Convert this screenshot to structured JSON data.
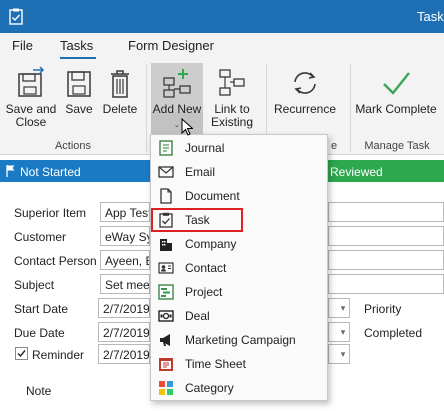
{
  "window": {
    "title": "Task"
  },
  "ribbon": {
    "tabs": [
      "File",
      "Tasks",
      "Form Designer"
    ],
    "buttons": {
      "save_and_close": "Save and\nClose",
      "save": "Save",
      "delete": "Delete",
      "add_new": "Add New",
      "link_to_existing": "Link to\nExisting",
      "recurrence": "Recurrence",
      "mark_complete": "Mark Complete"
    },
    "groups": {
      "actions": "Actions",
      "manage_task": "Manage Task",
      "recurrence_fragment": "e"
    }
  },
  "status": {
    "current_stage": "Not Started",
    "next_stage": "e Reviewed"
  },
  "form": {
    "superior_item": {
      "label": "Superior Item",
      "value": "App Test"
    },
    "customer": {
      "label": "Customer",
      "value": "eWay Sys"
    },
    "contact_person": {
      "label": "Contact Person",
      "value": "Ayeen, Ev"
    },
    "subject": {
      "label": "Subject",
      "value": "Set meetin"
    },
    "start_date": {
      "label": "Start Date",
      "value": "2/7/2019"
    },
    "due_date": {
      "label": "Due Date",
      "value": "2/7/2019"
    },
    "reminder": {
      "label": "Reminder",
      "value": "2/7/2019",
      "checked": true
    },
    "note": {
      "label": "Note"
    },
    "priority": {
      "label": "Priority"
    },
    "completed": {
      "label": "Completed"
    }
  },
  "add_new_menu": {
    "items": [
      "Journal",
      "Email",
      "Document",
      "Task",
      "Company",
      "Contact",
      "Project",
      "Deal",
      "Marketing Campaign",
      "Time Sheet",
      "Category"
    ],
    "highlighted": "Task"
  },
  "colors": {
    "titlebar": "#1f6fb5",
    "stage_current": "#1a7ac4",
    "stage_next": "#2ea84e",
    "highlight_box": "#e02020"
  }
}
